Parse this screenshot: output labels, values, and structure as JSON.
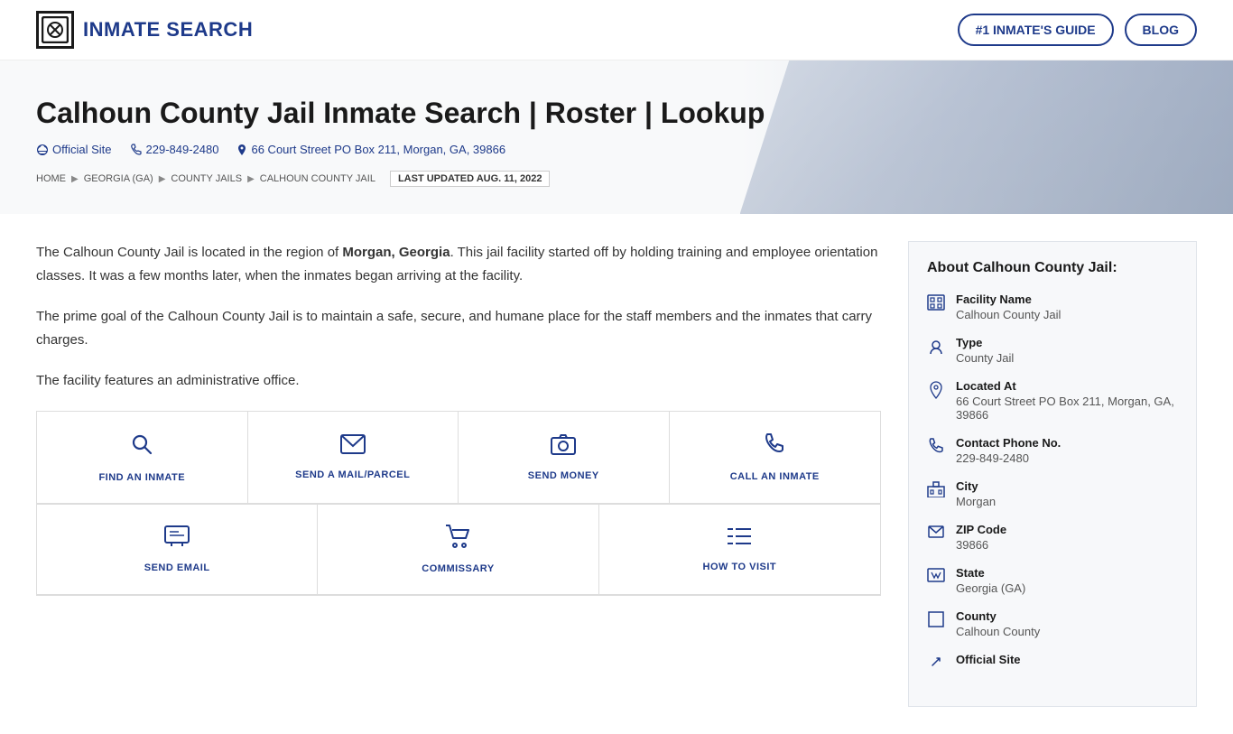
{
  "header": {
    "logo_icon": "⊞",
    "logo_text": "INMATE SEARCH",
    "nav_items": [
      {
        "label": "#1 INMATE'S GUIDE",
        "id": "inmates-guide"
      },
      {
        "label": "BLOG",
        "id": "blog"
      }
    ]
  },
  "hero": {
    "title": "Calhoun County Jail Inmate Search | Roster | Lookup",
    "official_site_label": "Official Site",
    "phone": "229-849-2480",
    "address": "66 Court Street PO Box 211, Morgan, GA, 39866",
    "breadcrumb": [
      {
        "label": "HOME",
        "url": "#"
      },
      {
        "label": "GEORGIA (GA)",
        "url": "#"
      },
      {
        "label": "COUNTY JAILS",
        "url": "#"
      },
      {
        "label": "CALHOUN COUNTY JAIL",
        "url": "#"
      }
    ],
    "last_updated": "LAST UPDATED AUG. 11, 2022"
  },
  "description": {
    "paragraph1_before": "The Calhoun County Jail is located in the region of ",
    "paragraph1_bold": "Morgan, Georgia",
    "paragraph1_after": ". This jail facility started off by holding training and employee orientation classes. It was a few months later, when the inmates began arriving at the facility.",
    "paragraph2": "The prime goal of the Calhoun County Jail is to maintain a safe, secure, and humane place for the staff members and the inmates that carry charges.",
    "paragraph3": "The facility features an administrative office."
  },
  "actions": [
    {
      "id": "find-inmate",
      "label": "FIND AN INMATE",
      "icon": "🔍"
    },
    {
      "id": "send-mail",
      "label": "SEND A MAIL/PARCEL",
      "icon": "✉"
    },
    {
      "id": "send-money",
      "label": "SEND MONEY",
      "icon": "📷"
    },
    {
      "id": "call-inmate",
      "label": "CALL AN INMATE",
      "icon": "📞"
    },
    {
      "id": "send-email",
      "label": "SEND EMAIL",
      "icon": "💬"
    },
    {
      "id": "commissary",
      "label": "COMMISSARY",
      "icon": "🛒"
    },
    {
      "id": "how-to-visit",
      "label": "HOW TO VISIT",
      "icon": "☰"
    }
  ],
  "sidebar": {
    "title": "About Calhoun County Jail:",
    "items": [
      {
        "id": "facility-name",
        "label": "Facility Name",
        "value": "Calhoun County Jail",
        "icon": "▦"
      },
      {
        "id": "type",
        "label": "Type",
        "value": "County Jail",
        "icon": "⚙"
      },
      {
        "id": "located-at",
        "label": "Located At",
        "value": "66 Court Street PO Box 211, Morgan, GA, 39866",
        "icon": "📍"
      },
      {
        "id": "contact-phone",
        "label": "Contact Phone No.",
        "value": "229-849-2480",
        "icon": "📞"
      },
      {
        "id": "city",
        "label": "City",
        "value": "Morgan",
        "icon": "🏛"
      },
      {
        "id": "zip-code",
        "label": "ZIP Code",
        "value": "39866",
        "icon": "✉"
      },
      {
        "id": "state",
        "label": "State",
        "value": "Georgia (GA)",
        "icon": "🗺"
      },
      {
        "id": "county",
        "label": "County",
        "value": "Calhoun County",
        "icon": "⬜"
      },
      {
        "id": "official-site",
        "label": "Official Site",
        "value": "",
        "icon": "🔗"
      }
    ]
  }
}
